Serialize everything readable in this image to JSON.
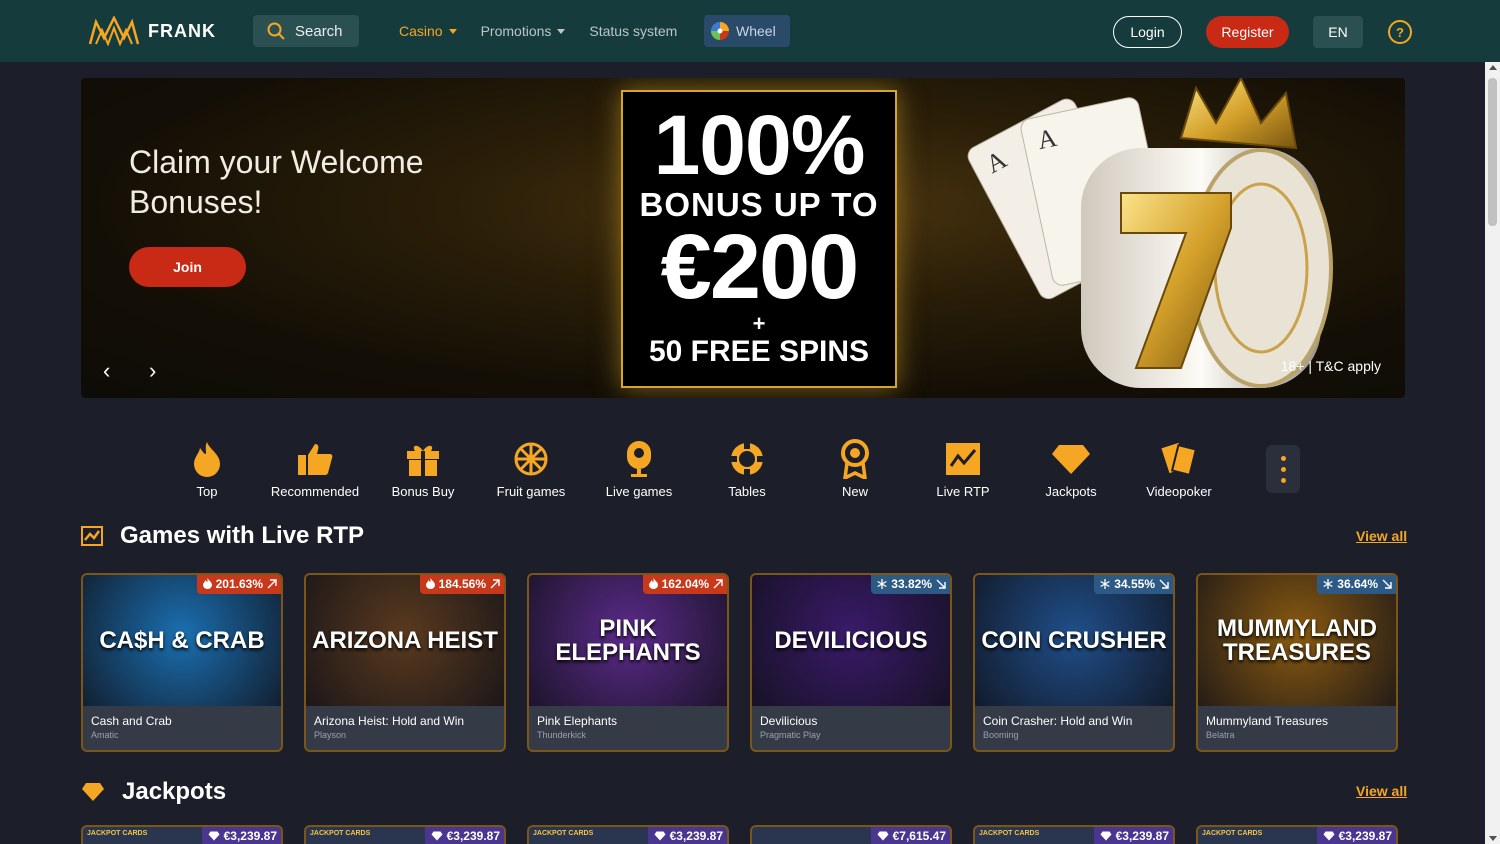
{
  "header": {
    "logo_text": "FRANK",
    "search_label": "Search",
    "nav": [
      {
        "label": "Casino",
        "active": true,
        "dropdown": true
      },
      {
        "label": "Promotions",
        "active": false,
        "dropdown": true
      },
      {
        "label": "Status system",
        "active": false,
        "dropdown": false
      }
    ],
    "wheel_label": "Wheel",
    "login_label": "Login",
    "register_label": "Register",
    "lang_label": "EN",
    "help_label": "?"
  },
  "banner": {
    "title": "Claim your Welcome Bonuses!",
    "join_label": "Join",
    "prev_arrow": "‹",
    "next_arrow": "›",
    "promo_pct": "100%",
    "promo_up": "BONUS UP TO",
    "promo_amount": "€200",
    "promo_plus": "+",
    "promo_spins": "50 FREE SPINS",
    "tc": "18+ | T&C apply"
  },
  "categories": [
    {
      "label": "Top",
      "icon": "fire-icon"
    },
    {
      "label": "Recommended",
      "icon": "thumbs-up-icon"
    },
    {
      "label": "Bonus Buy",
      "icon": "gift-icon"
    },
    {
      "label": "Fruit games",
      "icon": "fruit-icon"
    },
    {
      "label": "Live games",
      "icon": "live-icon"
    },
    {
      "label": "Tables",
      "icon": "chip-icon"
    },
    {
      "label": "New",
      "icon": "badge-icon"
    },
    {
      "label": "Live RTP",
      "icon": "chart-icon"
    },
    {
      "label": "Jackpots",
      "icon": "diamond-icon"
    },
    {
      "label": "Videopoker",
      "icon": "cards-icon"
    }
  ],
  "live_rtp": {
    "title": "Games with Live RTP",
    "view_all": "View all",
    "games": [
      {
        "name": "Cash and Crab",
        "provider": "Amatic",
        "rtp": "201.63%",
        "trend": "up",
        "thumb_text": "CA$H & CRAB",
        "thumb_color": "#1a6fb0"
      },
      {
        "name": "Arizona Heist: Hold and Win",
        "provider": "Playson",
        "rtp": "184.56%",
        "trend": "up",
        "thumb_text": "ARIZONA HEIST",
        "thumb_color": "#5a3a1e"
      },
      {
        "name": "Pink Elephants",
        "provider": "Thunderkick",
        "rtp": "162.04%",
        "trend": "up",
        "thumb_text": "PINK ELEPHANTS",
        "thumb_color": "#5b2a8a"
      },
      {
        "name": "Devilicious",
        "provider": "Pragmatic Play",
        "rtp": "33.82%",
        "trend": "down",
        "thumb_text": "DEVILICIOUS",
        "thumb_color": "#3a1a6a"
      },
      {
        "name": "Coin Crasher: Hold and Win",
        "provider": "Booming",
        "rtp": "34.55%",
        "trend": "down",
        "thumb_text": "COIN CRUSHER",
        "thumb_color": "#1f4f8a"
      },
      {
        "name": "Mummyland Treasures",
        "provider": "Belatra",
        "rtp": "36.64%",
        "trend": "down",
        "thumb_text": "MUMMYLAND TREASURES",
        "thumb_color": "#8a5a10"
      }
    ]
  },
  "jackpots": {
    "title": "Jackpots",
    "view_all": "View all",
    "items": [
      {
        "amount": "€3,239.87",
        "label": "JACKPOT CARDS"
      },
      {
        "amount": "€3,239.87",
        "label": "JACKPOT CARDS"
      },
      {
        "amount": "€3,239.87",
        "label": "JACKPOT CARDS"
      },
      {
        "amount": "€7,615.47",
        "label": ""
      },
      {
        "amount": "€3,239.87",
        "label": "JACKPOT CARDS"
      },
      {
        "amount": "€3,239.87",
        "label": "JACKPOT CARDS"
      }
    ]
  },
  "colors": {
    "accent": "#f5a623",
    "header_bg": "#163b3c",
    "page_bg": "#1c1f2a",
    "register": "#c82a16",
    "hot_badge": "#c8391b",
    "cold_badge": "#2d5a85"
  }
}
